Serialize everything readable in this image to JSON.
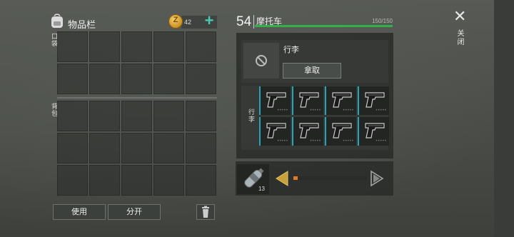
{
  "inventory": {
    "title": "物品栏",
    "coin_symbol": "Z",
    "coin_count": "42",
    "add_label": "+",
    "pocket_label": "口袋",
    "backpack_label": "背包",
    "use_label": "使用",
    "split_label": "分开"
  },
  "panel": {
    "level": "54",
    "title": "摩托车",
    "capacity": "150/150",
    "capacity_fraction": 1.0,
    "item_name": "行李",
    "take_label": "拿取",
    "luggage_label": "行李",
    "items": [
      {
        "icon": "pistol-icon"
      },
      {
        "icon": "pistol-icon"
      },
      {
        "icon": "pistol-icon"
      },
      {
        "icon": "pistol-icon"
      },
      {
        "icon": "pistol-icon"
      },
      {
        "icon": "pistol-icon"
      },
      {
        "icon": "pistol-icon"
      },
      {
        "icon": "pistol-icon"
      }
    ]
  },
  "quantity": {
    "item_icon": "bottle-icon",
    "count": "13",
    "slider_fraction": 0.06
  },
  "close": {
    "symbol": "✕",
    "label": "关闭"
  },
  "colors": {
    "capacity_bar": "#2fb347",
    "accent_teal": "#47c9b3",
    "slider_fill": "#e07a24",
    "arrow_gold": "#c8a13a"
  }
}
